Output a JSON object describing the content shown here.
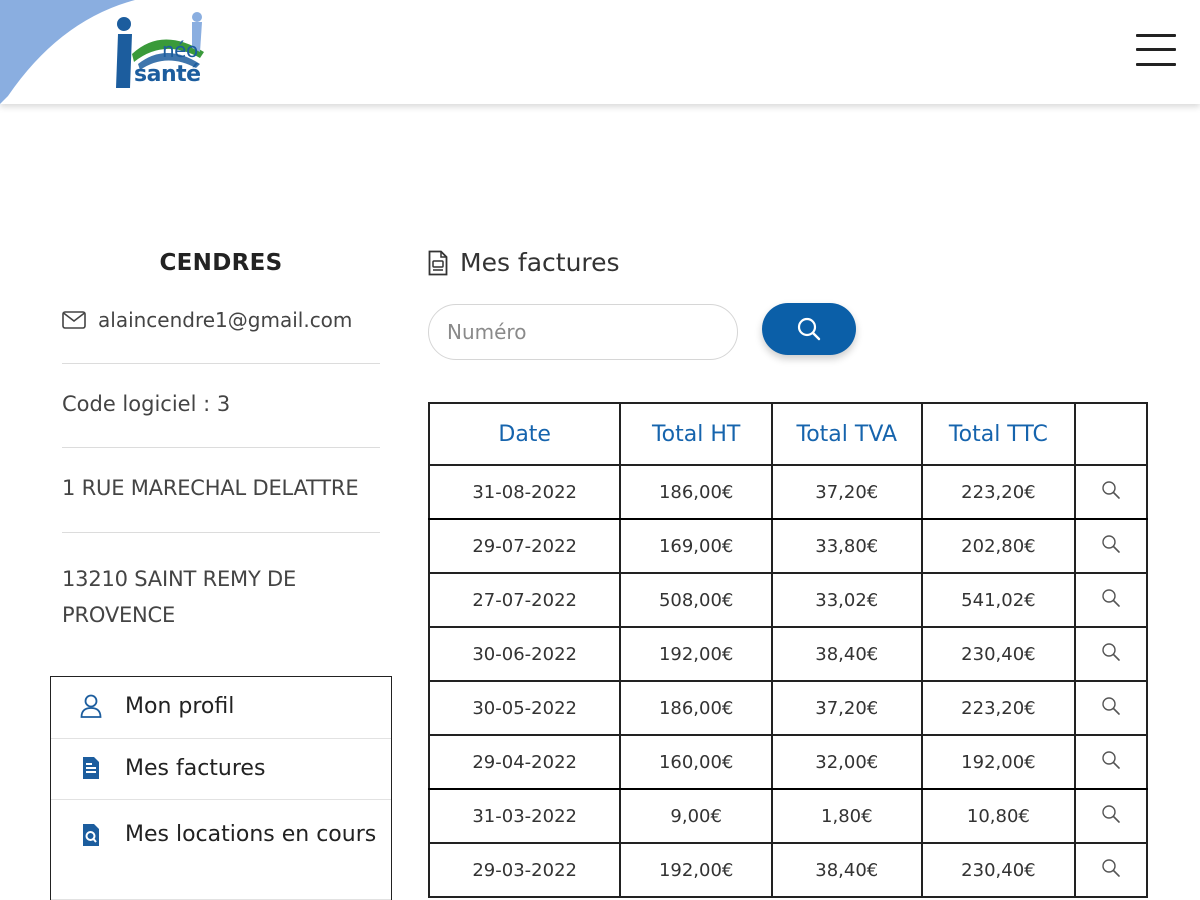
{
  "header": {
    "logo": {
      "line1": "néo",
      "line2": "santé"
    },
    "brand_colors": {
      "primary": "#1c5d9e",
      "green": "#3a9a3a",
      "swoosh": "#8aaee0"
    },
    "menu_icon": "hamburger-icon"
  },
  "profile": {
    "name": "CENDRES",
    "email": "alaincendre1@gmail.com",
    "email_icon": "envelope-icon",
    "code": "Code logiciel : 3",
    "address_line1": "1 RUE MARECHAL DELATTRE",
    "address_line2": "13210 SAINT REMY DE PROVENCE"
  },
  "menu": {
    "items": [
      {
        "label": "Mon profil",
        "icon": "user-icon"
      },
      {
        "label": "Mes factures",
        "icon": "document-icon"
      },
      {
        "label": "Mes locations en cours",
        "icon": "document-search-icon"
      }
    ]
  },
  "main": {
    "title": "Mes factures",
    "title_icon": "invoice-icon",
    "search": {
      "placeholder": "Numéro",
      "value": "",
      "button_icon": "search-icon",
      "button_color": "#0b5fa8"
    },
    "table": {
      "headers": [
        "Date",
        "Total HT",
        "Total TVA",
        "Total TTC",
        ""
      ],
      "rows": [
        [
          "31-08-2022",
          "186,00€",
          "37,20€",
          "223,20€"
        ],
        [
          "29-07-2022",
          "169,00€",
          "33,80€",
          "202,80€"
        ],
        [
          "27-07-2022",
          "508,00€",
          "33,02€",
          "541,02€"
        ],
        [
          "30-06-2022",
          "192,00€",
          "38,40€",
          "230,40€"
        ],
        [
          "30-05-2022",
          "186,00€",
          "37,20€",
          "223,20€"
        ],
        [
          "29-04-2022",
          "160,00€",
          "32,00€",
          "192,00€"
        ],
        [
          "31-03-2022",
          "9,00€",
          "1,80€",
          "10,80€"
        ],
        [
          "29-03-2022",
          "192,00€",
          "38,40€",
          "230,40€"
        ]
      ],
      "row_action_icon": "magnifier-icon"
    }
  }
}
